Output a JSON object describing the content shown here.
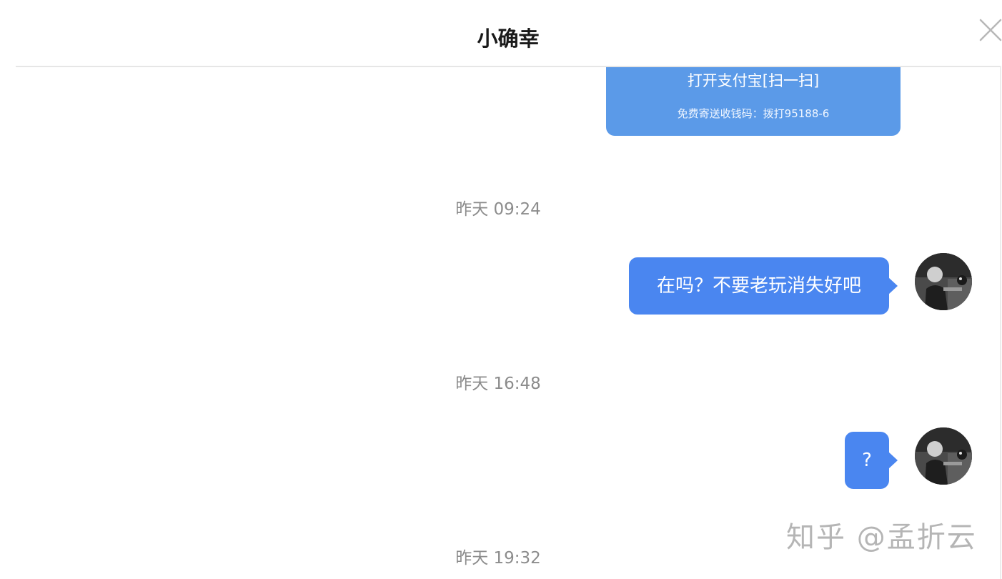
{
  "header": {
    "title": "小确幸",
    "close_icon": "close-icon"
  },
  "payment_card": {
    "line1": "打开支付宝[扫一扫]",
    "line2": "免费寄送收钱码：拨打95188-6",
    "color": "#5b9ae8"
  },
  "messages": [
    {
      "timestamp": "昨天 09:24",
      "text": "在吗？不要老玩消失好吧"
    },
    {
      "timestamp": "昨天 16:48",
      "text": "?"
    },
    {
      "timestamp": "昨天 19:32"
    }
  ],
  "colors": {
    "bubble": "#4a86f0",
    "timestamp": "#8c8c8c"
  },
  "watermark": "知乎 @孟折云"
}
